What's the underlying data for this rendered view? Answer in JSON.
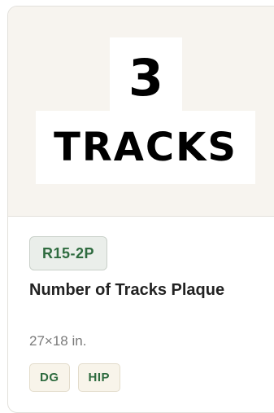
{
  "sign": {
    "line1": "3",
    "line2": "TRACKS"
  },
  "card": {
    "code": "R15-2P",
    "title": "Number of Tracks Plaque",
    "size": "27×18 in.",
    "tags": [
      "DG",
      "HIP"
    ]
  }
}
